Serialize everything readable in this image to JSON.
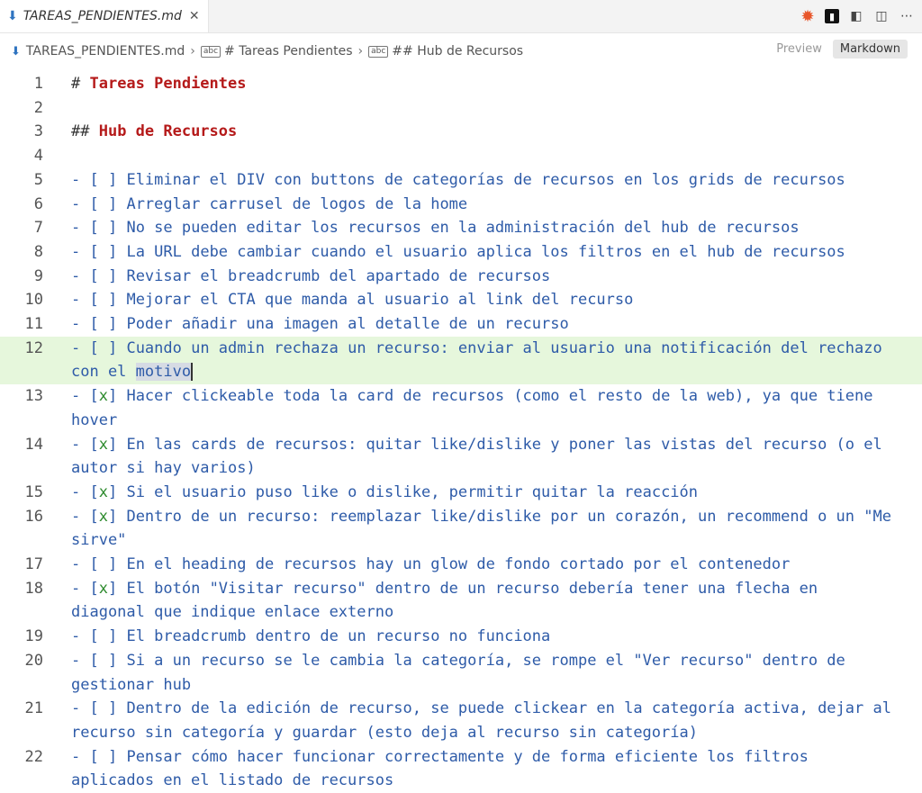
{
  "tab": {
    "title": "TAREAS_PENDIENTES.md",
    "close": "✕"
  },
  "breadcrumb": {
    "file": "TAREAS_PENDIENTES.md",
    "h1": "# Tareas Pendientes",
    "h2": "## Hub de Recursos"
  },
  "view_toggle": {
    "preview": "Preview",
    "markdown": "Markdown"
  },
  "lines": [
    {
      "n": "1",
      "kind": "h",
      "hash": "#",
      "text": "Tareas Pendientes"
    },
    {
      "n": "2",
      "kind": "blank"
    },
    {
      "n": "3",
      "kind": "h",
      "hash": "##",
      "text": "Hub de Recursos"
    },
    {
      "n": "4",
      "kind": "blank"
    },
    {
      "n": "5",
      "kind": "task",
      "state": " ",
      "text": "Eliminar el DIV con buttons de categorías de recursos en los grids de recursos"
    },
    {
      "n": "6",
      "kind": "task",
      "state": " ",
      "text": "Arreglar carrusel de logos de la home"
    },
    {
      "n": "7",
      "kind": "task",
      "state": " ",
      "text": "No se pueden editar los recursos en la administración del hub de recursos"
    },
    {
      "n": "8",
      "kind": "task",
      "state": " ",
      "text": "La URL debe cambiar cuando el usuario aplica los filtros en el hub de recursos"
    },
    {
      "n": "9",
      "kind": "task",
      "state": " ",
      "text": "Revisar el breadcrumb del apartado de recursos"
    },
    {
      "n": "10",
      "kind": "task",
      "state": " ",
      "text": "Mejorar el CTA que manda al usuario al link del recurso"
    },
    {
      "n": "11",
      "kind": "task",
      "state": " ",
      "text": "Poder añadir una imagen al detalle de un recurso"
    },
    {
      "n": "12",
      "kind": "task",
      "state": " ",
      "current": true,
      "text": "Cuando un admin rechaza un recurso: enviar al usuario una notificación del rechazo con el ",
      "selected": "motivo"
    },
    {
      "n": "13",
      "kind": "task",
      "state": "x",
      "text": "Hacer clickeable toda la card de recursos (como el resto de la web), ya que tiene hover"
    },
    {
      "n": "14",
      "kind": "task",
      "state": "x",
      "text": "En las cards de recursos: quitar like/dislike y poner las vistas del recurso (o el autor si hay varios)"
    },
    {
      "n": "15",
      "kind": "task",
      "state": "x",
      "text": "Si el usuario puso like o dislike, permitir quitar la reacción"
    },
    {
      "n": "16",
      "kind": "task",
      "state": "x",
      "text": "Dentro de un recurso: reemplazar like/dislike por un corazón, un recommend o un \"Me sirve\""
    },
    {
      "n": "17",
      "kind": "task",
      "state": " ",
      "text": "En el heading de recursos hay un glow de fondo cortado por el contenedor"
    },
    {
      "n": "18",
      "kind": "task",
      "state": "x",
      "text": "El botón \"Visitar recurso\" dentro de un recurso debería tener una flecha en diagonal que indique enlace externo"
    },
    {
      "n": "19",
      "kind": "task",
      "state": " ",
      "text": "El breadcrumb dentro de un recurso no funciona"
    },
    {
      "n": "20",
      "kind": "task",
      "state": " ",
      "text": "Si a un recurso se le cambia la categoría, se rompe el \"Ver recurso\" dentro de gestionar hub"
    },
    {
      "n": "21",
      "kind": "task",
      "state": " ",
      "text": "Dentro de la edición de recurso, se puede clickear en la categoría activa, dejar al recurso sin categoría y guardar (esto deja al recurso sin categoría)"
    },
    {
      "n": "22",
      "kind": "task",
      "state": " ",
      "text": "Pensar cómo hacer funcionar correctamente y de forma eficiente los filtros aplicados en el listado de recursos"
    }
  ],
  "colors": {
    "heading": "#b51a1a",
    "task_text": "#2e5ba8",
    "checked_x": "#2e8b2e",
    "current_line": "#e6f7dc"
  },
  "icons": [
    "markdown-file-icon",
    "close-icon",
    "copilot-sun-icon",
    "square-app-icon",
    "open-preview-icon",
    "split-editor-icon",
    "more-actions-icon",
    "chevron-right-icon",
    "abc-symbol-icon"
  ]
}
